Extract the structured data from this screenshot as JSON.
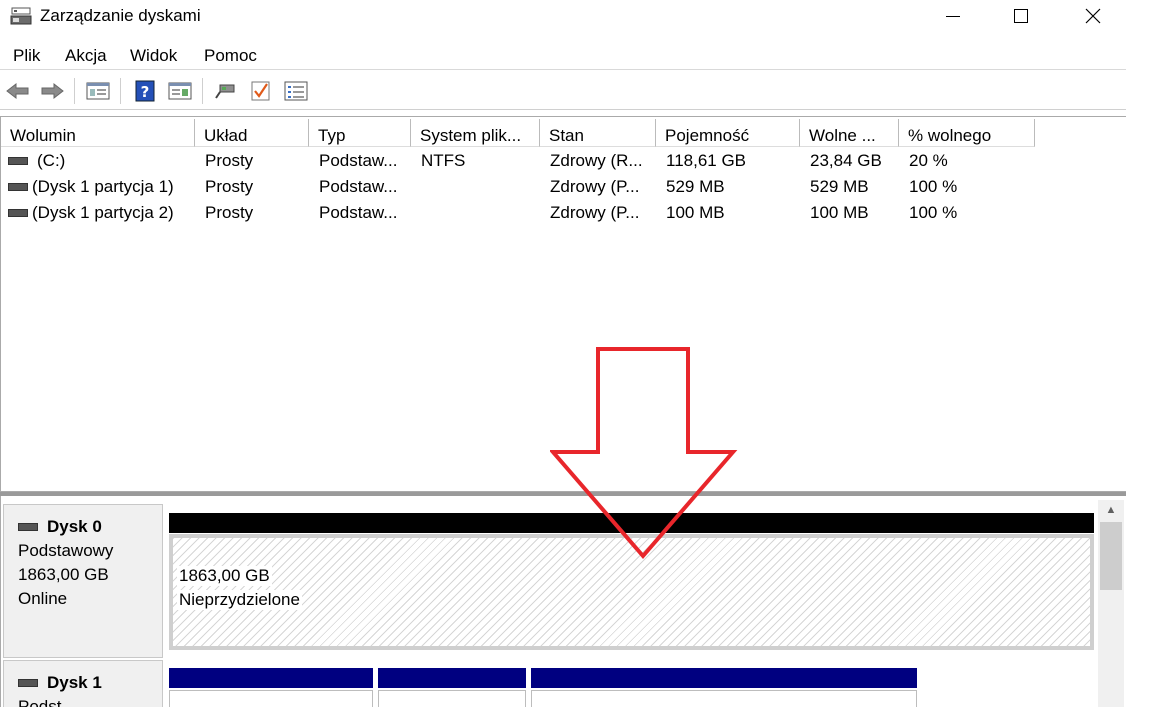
{
  "window": {
    "title": "Zarządzanie dyskami"
  },
  "menu": [
    "Plik",
    "Akcja",
    "Widok",
    "Pomoc"
  ],
  "toolbar_icons": [
    "back-arrow-icon",
    "forward-arrow-icon",
    "console-view-icon",
    "help-icon",
    "properties-view-icon",
    "connect-icon",
    "check-icon",
    "list-view-icon"
  ],
  "volume_table": {
    "columns": [
      "Wolumin",
      "Układ",
      "Typ",
      "System plik...",
      "Stan",
      "Pojemność",
      "Wolne ...",
      "% wolnego"
    ],
    "rows": [
      [
        "(C:)",
        "Prosty",
        "Podstaw...",
        "NTFS",
        "Zdrowy (R...",
        "118,61 GB",
        "23,84 GB",
        "20 %"
      ],
      [
        "(Dysk 1 partycja 1)",
        "Prosty",
        "Podstaw...",
        "",
        "Zdrowy (P...",
        "529 MB",
        "529 MB",
        "100 %"
      ],
      [
        "(Dysk 1 partycja 2)",
        "Prosty",
        "Podstaw...",
        "",
        "Zdrowy (P...",
        "100 MB",
        "100 MB",
        "100 %"
      ]
    ]
  },
  "disks": [
    {
      "name": "Dysk 0",
      "type": "Podstawowy",
      "size": "1863,00 GB",
      "status": "Online",
      "unallocated_size": "1863,00 GB",
      "unallocated_label": "Nieprzydzielone"
    },
    {
      "name": "Dysk 1",
      "type": "Podst"
    }
  ],
  "colors": {
    "arrow": "#e8262b",
    "partition_primary": "#000080",
    "unallocated_bar": "#000000"
  }
}
